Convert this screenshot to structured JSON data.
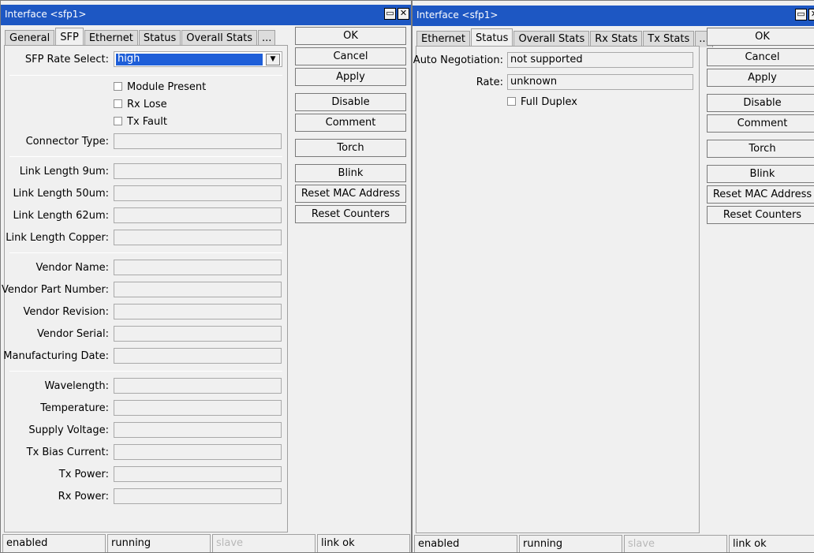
{
  "window1": {
    "title": "Interface <sfp1>",
    "title_buttons": [
      "restore-icon",
      "close-icon"
    ],
    "tabs": [
      "General",
      "SFP",
      "Ethernet",
      "Status",
      "Overall Stats",
      "..."
    ],
    "active_tab": "SFP",
    "sfp_rate": {
      "label": "SFP Rate Select:",
      "value": "high"
    },
    "checkboxes": [
      {
        "label": "Module Present",
        "checked": false
      },
      {
        "label": "Rx Lose",
        "checked": false
      },
      {
        "label": "Tx Fault",
        "checked": false
      }
    ],
    "connector_type_label": "Connector Type:",
    "link_fields": [
      "Link Length 9um:",
      "Link Length 50um:",
      "Link Length 62um:",
      "Link Length Copper:"
    ],
    "vendor_fields": [
      "Vendor Name:",
      "Vendor Part Number:",
      "Vendor Revision:",
      "Vendor Serial:",
      "Manufacturing Date:"
    ],
    "optic_fields": [
      "Wavelength:",
      "Temperature:",
      "Supply Voltage:",
      "Tx Bias Current:",
      "Tx Power:",
      "Rx Power:"
    ],
    "buttons": [
      "OK",
      "Cancel",
      "Apply",
      "Disable",
      "Comment",
      "Torch",
      "Blink",
      "Reset MAC Address",
      "Reset Counters"
    ],
    "statusbar": [
      "enabled",
      "running",
      "slave",
      "link ok"
    ]
  },
  "window2": {
    "title": "Interface <sfp1>",
    "title_buttons": [
      "restore-icon",
      "close-icon"
    ],
    "tabs": [
      "Ethernet",
      "Status",
      "Overall Stats",
      "Rx Stats",
      "Tx Stats",
      "..."
    ],
    "active_tab": "Status",
    "auto_negotiation": {
      "label": "Auto Negotiation:",
      "value": "not supported"
    },
    "rate": {
      "label": "Rate:",
      "value": "unknown"
    },
    "full_duplex": {
      "label": "Full Duplex",
      "checked": false
    },
    "buttons": [
      "OK",
      "Cancel",
      "Apply",
      "Disable",
      "Comment",
      "Torch",
      "Blink",
      "Reset MAC Address",
      "Reset Counters"
    ],
    "statusbar": [
      "enabled",
      "running",
      "slave",
      "link ok"
    ]
  },
  "colors": {
    "titlebar": "#1d57c3",
    "selection": "#1e5ed8",
    "background": "#f0f0f0"
  }
}
